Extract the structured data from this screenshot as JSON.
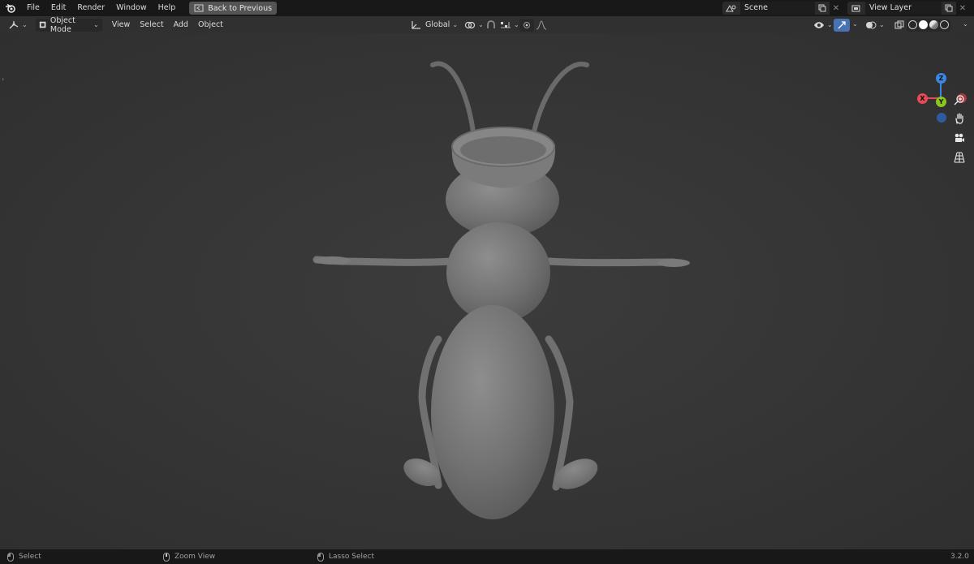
{
  "topbar": {
    "menus": [
      "File",
      "Edit",
      "Render",
      "Window",
      "Help"
    ],
    "back_button": "Back to Previous",
    "scene_name": "Scene",
    "view_layer_name": "View Layer"
  },
  "header": {
    "mode": "Object Mode",
    "menus": [
      "View",
      "Select",
      "Add",
      "Object"
    ],
    "transform_orientation": "Global"
  },
  "gizmo": {
    "z_label": "Z",
    "x_label": "X",
    "y_label": "Y",
    "colors": {
      "x": "#e34b56",
      "y": "#8bc61f",
      "z": "#3a87e6"
    }
  },
  "status": {
    "select": "Select",
    "zoom": "Zoom View",
    "lasso": "Lasso Select",
    "version": "3.2.0"
  },
  "icons": [
    "blender-logo-icon",
    "back-icon",
    "scene-icon",
    "view-layer-icon",
    "editor-type-icon",
    "object-mode-icon",
    "pivot-icon",
    "snap-icon",
    "proportional-icon",
    "visibility-icon",
    "gizmo-icon",
    "overlay-icon",
    "xray-icon",
    "wireframe-icon",
    "solid-icon",
    "material-icon",
    "rendered-icon",
    "zoom-icon",
    "hand-icon",
    "camera-icon",
    "grid-icon"
  ]
}
